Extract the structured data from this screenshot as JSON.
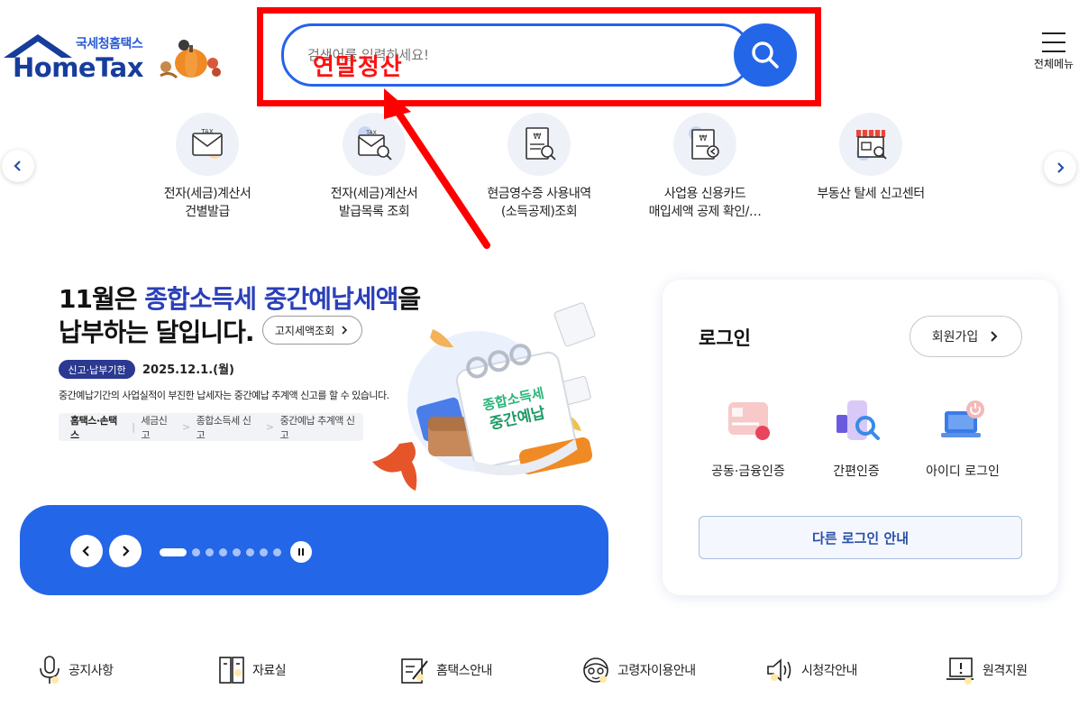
{
  "header": {
    "logo_sub": "국세청홈택스",
    "logo_main": "HomeTax",
    "search_placeholder": "검색어를 입력하세요!",
    "search_typed": "연말정산",
    "menu_label": "전체메뉴"
  },
  "quick_services": [
    {
      "icon": "tax-invoice-issue-icon",
      "label_1": "전자(세금)계산서",
      "label_2": "건별발급"
    },
    {
      "icon": "tax-invoice-search-icon",
      "label_1": "전자(세금)계산서",
      "label_2": "발급목록 조회"
    },
    {
      "icon": "cash-receipt-icon",
      "label_1": "현금영수증 사용내역",
      "label_2": "(소득공제)조회"
    },
    {
      "icon": "business-card-icon",
      "label_1": "사업용 신용카드",
      "label_2": "매입세액 공제 확인/…"
    },
    {
      "icon": "real-estate-icon",
      "label_1": "부동산 탈세 신고센터",
      "label_2": ""
    }
  ],
  "banner": {
    "title_a": "11월은 ",
    "title_hl": "종합소득세 중간예납세액",
    "title_b": "을",
    "title_line2": "납부하는 달입니다.",
    "tax_button": "고지세액조회",
    "due_badge": "신고·납부기한",
    "due_date": "2025.12.1.(월)",
    "description": "중간예납기간의 사업실적이 부진한 납세자는 중간예납 추계액 신고를 할 수 있습니다.",
    "breadcrumb_root": "홈택스·손택스",
    "breadcrumb": [
      "세금신고",
      "종합소득세 신고",
      "중간예납 추계액 신고"
    ],
    "calendar_text_1": "종합소득세",
    "calendar_text_2": "중간예납"
  },
  "slider": {
    "dot_count": 8,
    "active_index": 0
  },
  "login": {
    "title": "로그인",
    "signup": "회원가입",
    "options": [
      {
        "icon": "certificate-icon",
        "label": "공동·금융인증"
      },
      {
        "icon": "simple-auth-icon",
        "label": "간편인증"
      },
      {
        "icon": "id-login-icon",
        "label": "아이디 로그인"
      }
    ],
    "other": "다른 로그인 안내"
  },
  "footer_links": [
    {
      "icon": "microphone-icon",
      "label": "공지사항"
    },
    {
      "icon": "archive-icon",
      "label": "자료실"
    },
    {
      "icon": "edit-document-icon",
      "label": "홈택스안내"
    },
    {
      "icon": "senior-icon",
      "label": "고령자이용안내"
    },
    {
      "icon": "speaker-icon",
      "label": "시청각안내"
    },
    {
      "icon": "remote-support-icon",
      "label": "원격지원"
    }
  ],
  "colors": {
    "brand_blue": "#2466e8",
    "logo_navy": "#163d9c",
    "annotation_red": "#ff0000"
  }
}
